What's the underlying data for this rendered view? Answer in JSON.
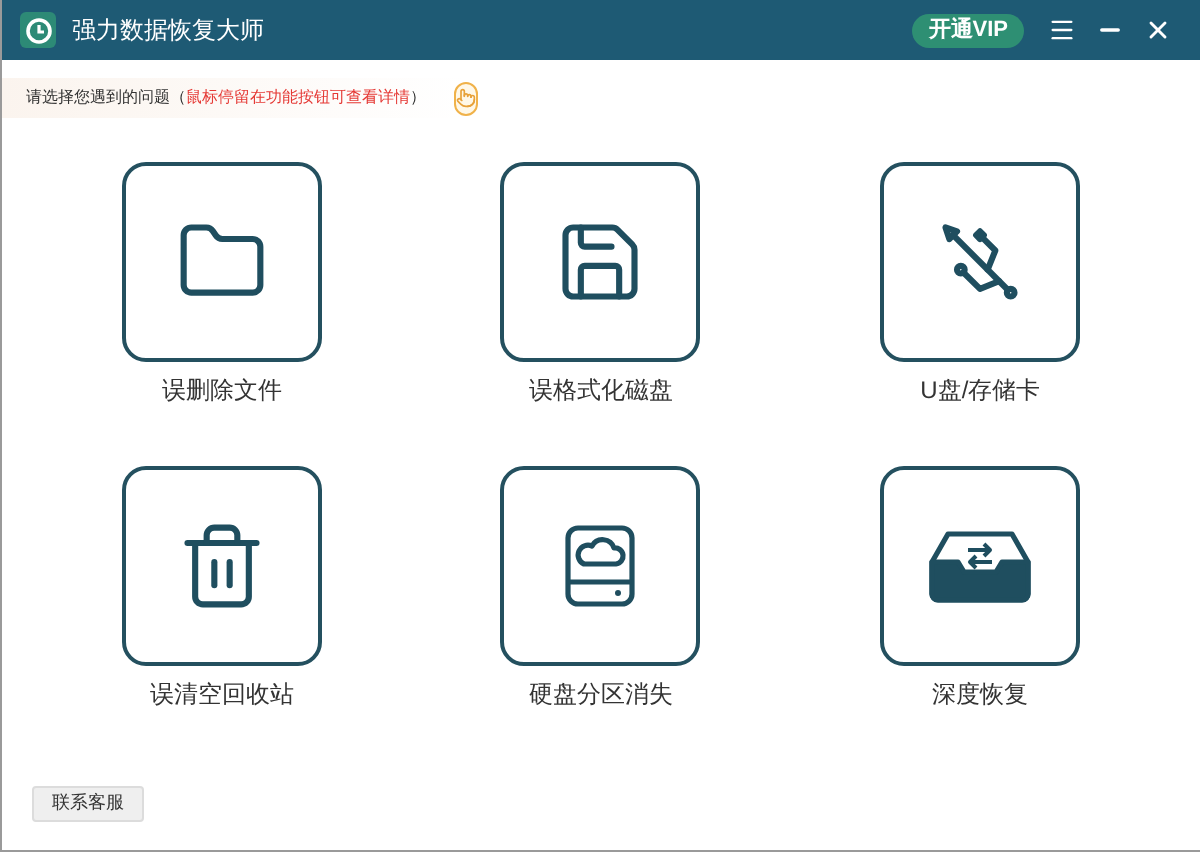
{
  "window": {
    "title": "强力数据恢复大师",
    "vip_button": "开通VIP"
  },
  "hint": {
    "prompt": "请选择您遇到的问题（",
    "detail": "鼠标停留在功能按钮可查看详情",
    "close_paren": "）"
  },
  "functions": [
    {
      "kind": "folder",
      "label": "误删除文件"
    },
    {
      "kind": "floppy",
      "label": "误格式化磁盘"
    },
    {
      "kind": "usb",
      "label": "U盘/存储卡"
    },
    {
      "kind": "trash",
      "label": "误清空回收站"
    },
    {
      "kind": "drive",
      "label": "硬盘分区消失"
    },
    {
      "kind": "deep",
      "label": "深度恢复"
    }
  ],
  "footer": {
    "support_button": "联系客服"
  }
}
